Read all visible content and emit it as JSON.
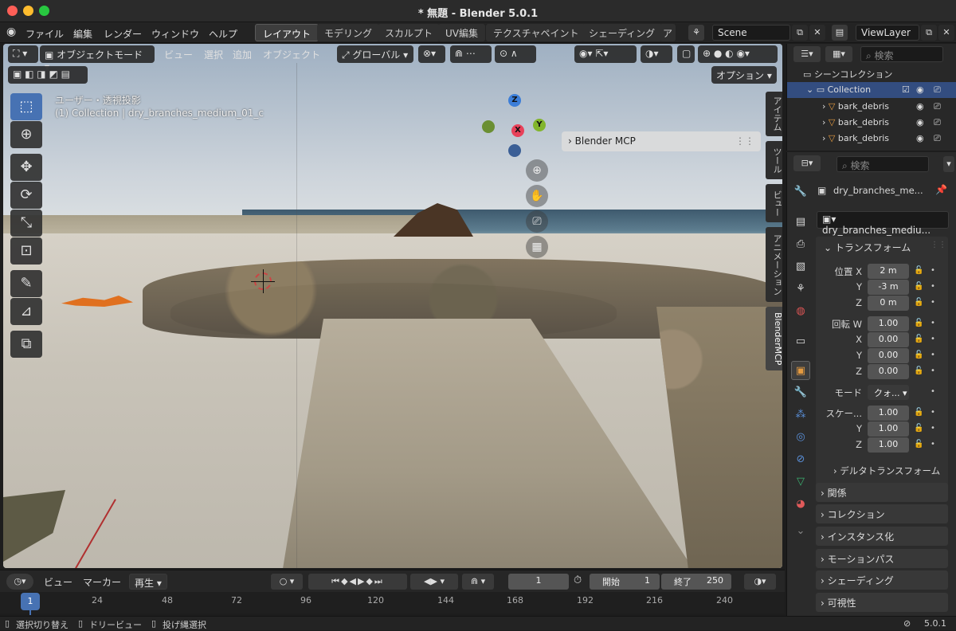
{
  "window": {
    "title": "* 無題 - Blender 5.0.1"
  },
  "menubar": {
    "menus": [
      "ファイル",
      "編集",
      "レンダー",
      "ウィンドウ",
      "ヘルプ"
    ],
    "workspaces": [
      "レイアウト",
      "モデリング",
      "スカルプト",
      "UV編集",
      "テクスチャペイント",
      "シェーディング",
      "ア"
    ],
    "scene": "Scene",
    "view_layer": "ViewLayer"
  },
  "viewport_header": {
    "mode": "オブジェクトモード",
    "menus": [
      "ビュー",
      "選択",
      "追加",
      "オブジェクト"
    ],
    "transform_orientation": "グローバル",
    "options": "オプション"
  },
  "viewport": {
    "view_name": "ユーザー・透視投影",
    "object_info": "(1) Collection | dry_branches_medium_01_c",
    "gizmo_axes": {
      "z": "Z",
      "y": "Y",
      "x": "X"
    },
    "sidebar_tabs": [
      "アイテム",
      "ツール",
      "ビュー",
      "アニメーション",
      "BlenderMCP"
    ],
    "panel_title": "Blender MCP"
  },
  "outliner": {
    "search_placeholder": "検索",
    "root": "シーンコレクション",
    "collection": "Collection",
    "items": [
      "bark_debris",
      "bark_debris",
      "bark_debris"
    ]
  },
  "properties": {
    "search_placeholder": "検索",
    "object_name": "dry_branches_me...",
    "object_data_name": "dry_branches_mediu...",
    "transform_title": "トランスフォーム",
    "location_label": "位置 X",
    "location": {
      "x": "2 m",
      "y": "-3 m",
      "z": "0 m"
    },
    "rotation_label": "回転 W",
    "rotation": {
      "w": "1.00",
      "x": "0.00",
      "y": "0.00",
      "z": "0.00"
    },
    "mode_label": "モード",
    "mode_value": "クォ...",
    "scale_label": "スケー...",
    "scale": {
      "x": "1.00",
      "y": "1.00",
      "z": "1.00"
    },
    "axis_labels": {
      "x": "X",
      "y": "Y",
      "z": "Z"
    },
    "delta_transform": "デルタトランスフォーム",
    "sections": [
      "関係",
      "コレクション",
      "インスタンス化",
      "モーションパス",
      "シェーディング",
      "可視性"
    ]
  },
  "timeline": {
    "menus": [
      "ビュー",
      "マーカー"
    ],
    "playback": "再生",
    "current_frame": "1",
    "start_label": "開始",
    "start": "1",
    "end_label": "終了",
    "end": "250",
    "ticks": [
      "1",
      "24",
      "48",
      "72",
      "96",
      "120",
      "144",
      "168",
      "192",
      "216",
      "240"
    ]
  },
  "statusbar": {
    "items": [
      "選択切り替え",
      "ドリービュー",
      "投げ縄選択"
    ],
    "version": "5.0.1"
  },
  "colors": {
    "accent": "#4772b3",
    "x_axis": "#e8415a",
    "y_axis": "#82b52c",
    "z_axis": "#3c7ed8",
    "selected_object": "#e0701f"
  }
}
